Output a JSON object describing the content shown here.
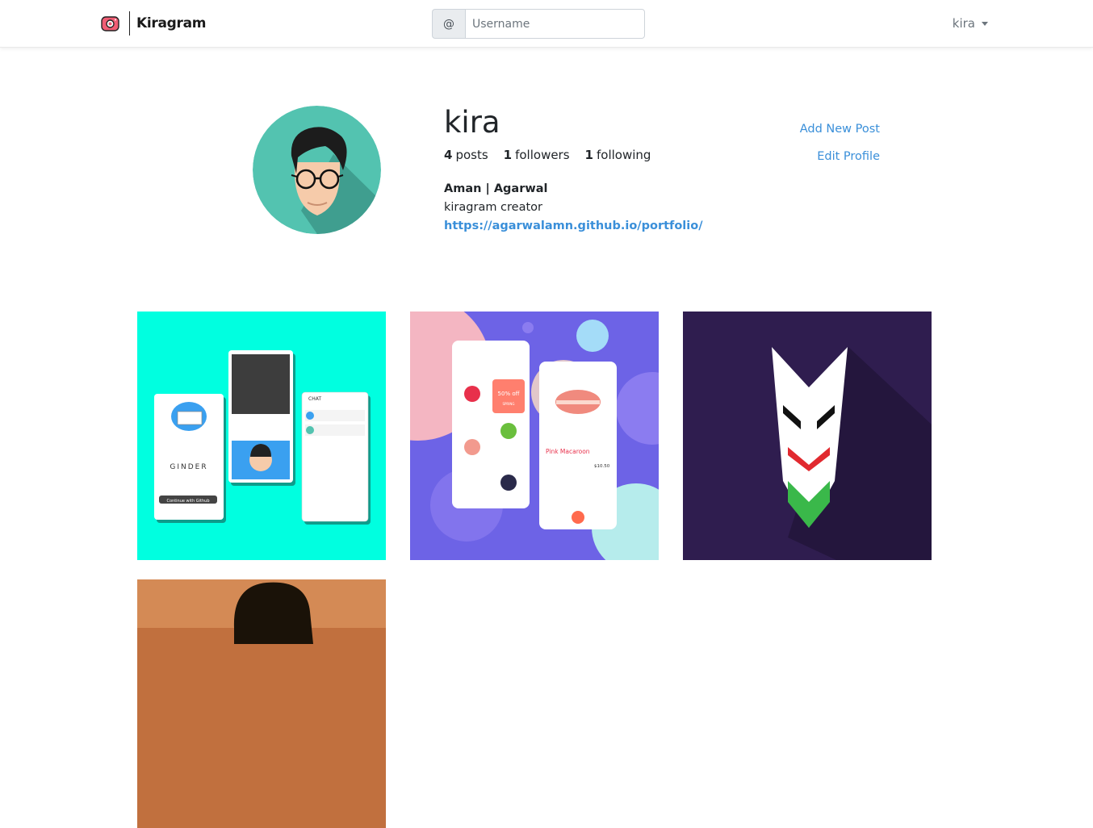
{
  "navbar": {
    "brand_name": "Kiragram",
    "search": {
      "addon": "@",
      "placeholder": "Username",
      "value": ""
    },
    "user_menu_label": "kira"
  },
  "profile": {
    "username": "kira",
    "stats": [
      {
        "count": "4",
        "label": "posts"
      },
      {
        "count": "1",
        "label": "followers"
      },
      {
        "count": "1",
        "label": "following"
      }
    ],
    "full_name": "Aman | Agarwal",
    "bio": "kiragram creator",
    "website": "https://agarwalamn.github.io/portfolio/",
    "actions": {
      "add_post": "Add New Post",
      "edit_profile": "Edit Profile"
    }
  },
  "posts": [
    {
      "name": "ginder-app-mockup",
      "mockup_title": "GINDER",
      "chat_label": "CHAT",
      "button_label": "Continue with Github"
    },
    {
      "name": "grocery-app-mockup",
      "product_name": "Pink Macaroon",
      "price": "$10.50",
      "promo": "50% off",
      "promo_sub": "SPRING"
    },
    {
      "name": "mask-logo"
    },
    {
      "name": "portrait-photo"
    }
  ],
  "colors": {
    "link": "#3a8fd9",
    "avatar_bg": "#53c3b0",
    "post1_bg": "#00ffe0",
    "post2_bg": "#6d63e6",
    "post3_bg": "#2f1d4f"
  }
}
